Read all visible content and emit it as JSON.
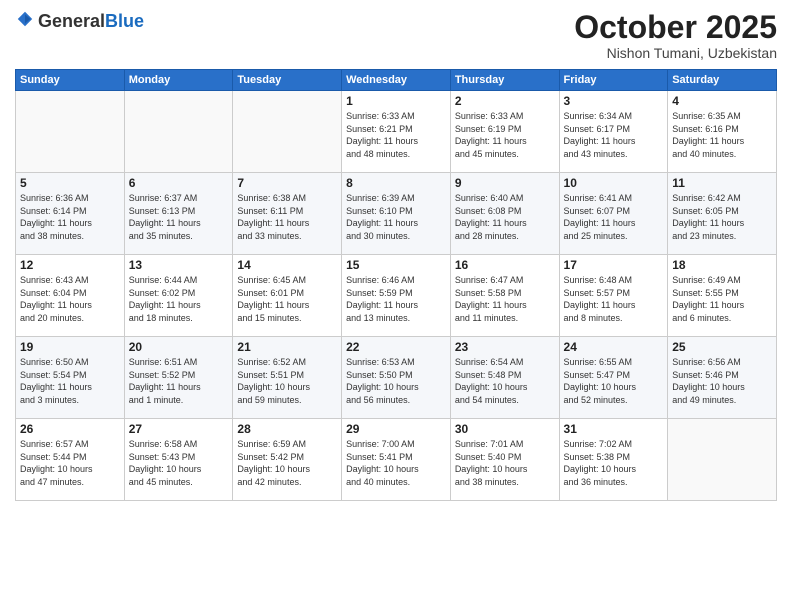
{
  "logo": {
    "general": "General",
    "blue": "Blue"
  },
  "header": {
    "month": "October 2025",
    "location": "Nishon Tumani, Uzbekistan"
  },
  "weekdays": [
    "Sunday",
    "Monday",
    "Tuesday",
    "Wednesday",
    "Thursday",
    "Friday",
    "Saturday"
  ],
  "weeks": [
    [
      {
        "day": "",
        "info": ""
      },
      {
        "day": "",
        "info": ""
      },
      {
        "day": "",
        "info": ""
      },
      {
        "day": "1",
        "info": "Sunrise: 6:33 AM\nSunset: 6:21 PM\nDaylight: 11 hours\nand 48 minutes."
      },
      {
        "day": "2",
        "info": "Sunrise: 6:33 AM\nSunset: 6:19 PM\nDaylight: 11 hours\nand 45 minutes."
      },
      {
        "day": "3",
        "info": "Sunrise: 6:34 AM\nSunset: 6:17 PM\nDaylight: 11 hours\nand 43 minutes."
      },
      {
        "day": "4",
        "info": "Sunrise: 6:35 AM\nSunset: 6:16 PM\nDaylight: 11 hours\nand 40 minutes."
      }
    ],
    [
      {
        "day": "5",
        "info": "Sunrise: 6:36 AM\nSunset: 6:14 PM\nDaylight: 11 hours\nand 38 minutes."
      },
      {
        "day": "6",
        "info": "Sunrise: 6:37 AM\nSunset: 6:13 PM\nDaylight: 11 hours\nand 35 minutes."
      },
      {
        "day": "7",
        "info": "Sunrise: 6:38 AM\nSunset: 6:11 PM\nDaylight: 11 hours\nand 33 minutes."
      },
      {
        "day": "8",
        "info": "Sunrise: 6:39 AM\nSunset: 6:10 PM\nDaylight: 11 hours\nand 30 minutes."
      },
      {
        "day": "9",
        "info": "Sunrise: 6:40 AM\nSunset: 6:08 PM\nDaylight: 11 hours\nand 28 minutes."
      },
      {
        "day": "10",
        "info": "Sunrise: 6:41 AM\nSunset: 6:07 PM\nDaylight: 11 hours\nand 25 minutes."
      },
      {
        "day": "11",
        "info": "Sunrise: 6:42 AM\nSunset: 6:05 PM\nDaylight: 11 hours\nand 23 minutes."
      }
    ],
    [
      {
        "day": "12",
        "info": "Sunrise: 6:43 AM\nSunset: 6:04 PM\nDaylight: 11 hours\nand 20 minutes."
      },
      {
        "day": "13",
        "info": "Sunrise: 6:44 AM\nSunset: 6:02 PM\nDaylight: 11 hours\nand 18 minutes."
      },
      {
        "day": "14",
        "info": "Sunrise: 6:45 AM\nSunset: 6:01 PM\nDaylight: 11 hours\nand 15 minutes."
      },
      {
        "day": "15",
        "info": "Sunrise: 6:46 AM\nSunset: 5:59 PM\nDaylight: 11 hours\nand 13 minutes."
      },
      {
        "day": "16",
        "info": "Sunrise: 6:47 AM\nSunset: 5:58 PM\nDaylight: 11 hours\nand 11 minutes."
      },
      {
        "day": "17",
        "info": "Sunrise: 6:48 AM\nSunset: 5:57 PM\nDaylight: 11 hours\nand 8 minutes."
      },
      {
        "day": "18",
        "info": "Sunrise: 6:49 AM\nSunset: 5:55 PM\nDaylight: 11 hours\nand 6 minutes."
      }
    ],
    [
      {
        "day": "19",
        "info": "Sunrise: 6:50 AM\nSunset: 5:54 PM\nDaylight: 11 hours\nand 3 minutes."
      },
      {
        "day": "20",
        "info": "Sunrise: 6:51 AM\nSunset: 5:52 PM\nDaylight: 11 hours\nand 1 minute."
      },
      {
        "day": "21",
        "info": "Sunrise: 6:52 AM\nSunset: 5:51 PM\nDaylight: 10 hours\nand 59 minutes."
      },
      {
        "day": "22",
        "info": "Sunrise: 6:53 AM\nSunset: 5:50 PM\nDaylight: 10 hours\nand 56 minutes."
      },
      {
        "day": "23",
        "info": "Sunrise: 6:54 AM\nSunset: 5:48 PM\nDaylight: 10 hours\nand 54 minutes."
      },
      {
        "day": "24",
        "info": "Sunrise: 6:55 AM\nSunset: 5:47 PM\nDaylight: 10 hours\nand 52 minutes."
      },
      {
        "day": "25",
        "info": "Sunrise: 6:56 AM\nSunset: 5:46 PM\nDaylight: 10 hours\nand 49 minutes."
      }
    ],
    [
      {
        "day": "26",
        "info": "Sunrise: 6:57 AM\nSunset: 5:44 PM\nDaylight: 10 hours\nand 47 minutes."
      },
      {
        "day": "27",
        "info": "Sunrise: 6:58 AM\nSunset: 5:43 PM\nDaylight: 10 hours\nand 45 minutes."
      },
      {
        "day": "28",
        "info": "Sunrise: 6:59 AM\nSunset: 5:42 PM\nDaylight: 10 hours\nand 42 minutes."
      },
      {
        "day": "29",
        "info": "Sunrise: 7:00 AM\nSunset: 5:41 PM\nDaylight: 10 hours\nand 40 minutes."
      },
      {
        "day": "30",
        "info": "Sunrise: 7:01 AM\nSunset: 5:40 PM\nDaylight: 10 hours\nand 38 minutes."
      },
      {
        "day": "31",
        "info": "Sunrise: 7:02 AM\nSunset: 5:38 PM\nDaylight: 10 hours\nand 36 minutes."
      },
      {
        "day": "",
        "info": ""
      }
    ]
  ]
}
